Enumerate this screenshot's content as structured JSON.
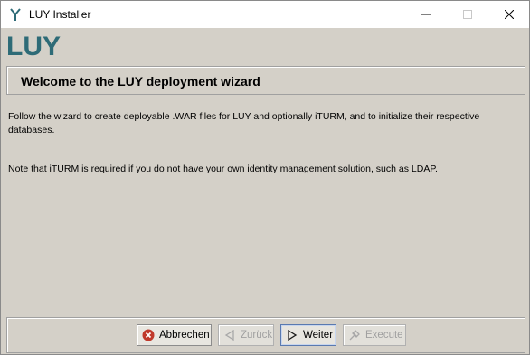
{
  "window": {
    "title": "LUY Installer"
  },
  "logo": {
    "text": "LUY",
    "color": "#2e6b77"
  },
  "header": {
    "title": "Welcome to the LUY deployment wizard"
  },
  "body": {
    "paragraph1": "Follow the wizard to create deployable .WAR files for LUY and optionally iTURM, and to initialize their respective databases.",
    "paragraph2": "Note that iTURM is required if you do not have your own identity management solution, such as LDAP."
  },
  "buttons": {
    "cancel": {
      "label": "Abbrechen",
      "icon": "cancel-icon",
      "enabled": true
    },
    "back": {
      "label": "Zurück",
      "icon": "arrow-left-icon",
      "enabled": false
    },
    "next": {
      "label": "Weiter",
      "icon": "arrow-right-icon",
      "enabled": true
    },
    "execute": {
      "label": "Execute",
      "icon": "execute-icon",
      "enabled": false
    }
  },
  "colors": {
    "background": "#d4d0c8",
    "titlebar": "#ffffff",
    "cancel_red": "#c0392b"
  }
}
